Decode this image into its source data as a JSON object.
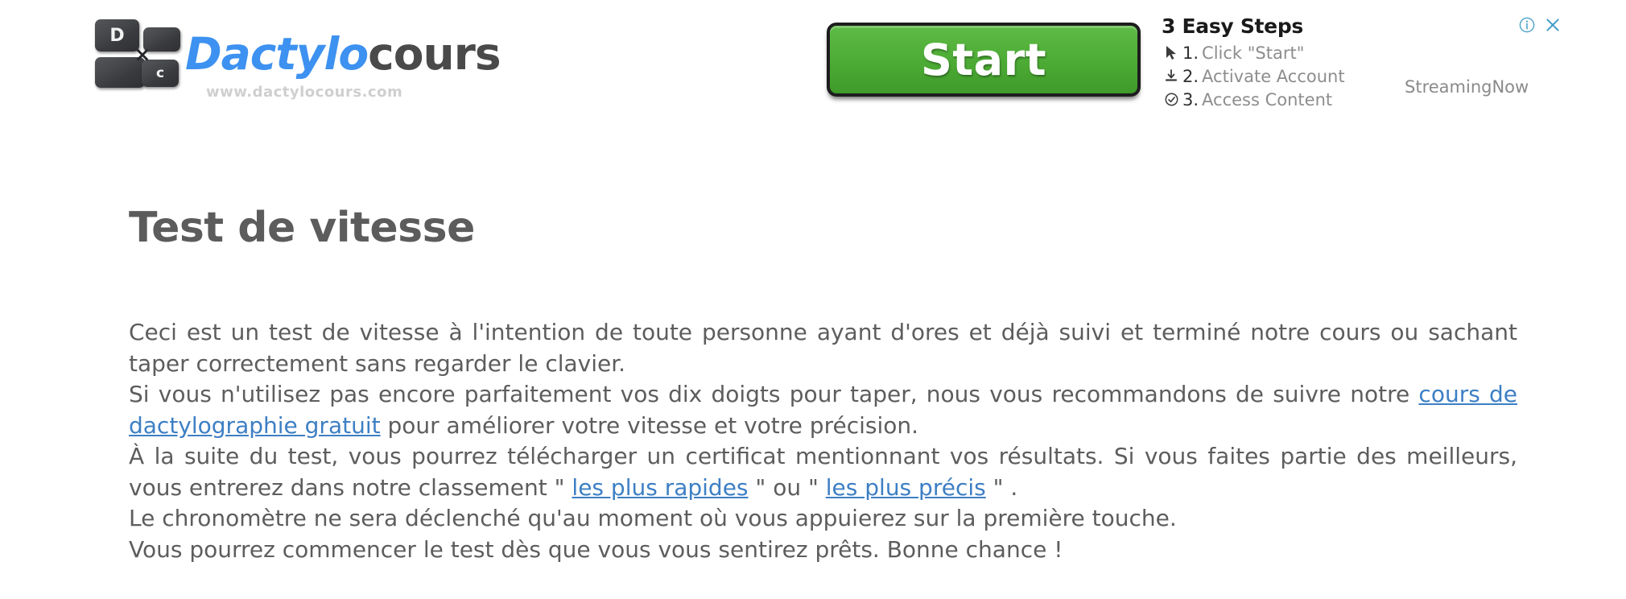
{
  "header": {
    "logo": {
      "key_top_left": "D",
      "key_bottom_right": "c",
      "key_x": "×",
      "brand_part1": "Dactylo",
      "brand_part2": "cours",
      "url": "www.dactylocours.com"
    },
    "ad": {
      "start_label": "Start",
      "steps_title": "3 Easy Steps",
      "steps": [
        {
          "icon": "cursor-arrow-icon",
          "glyph": "➤",
          "num": "1.",
          "label": "Click \"Start\""
        },
        {
          "icon": "download-icon",
          "glyph": "⤓",
          "num": "2.",
          "label": "Activate Account"
        },
        {
          "icon": "check-circle-icon",
          "glyph": "✓",
          "num": "3.",
          "label": "Access Content"
        }
      ],
      "brand": "StreamingNow",
      "info_glyph": "ⓘ",
      "close_glyph": "✕",
      "accent_color": "#3d9bc7",
      "button_color": "#4fae37"
    }
  },
  "main": {
    "title": "Test de vitesse",
    "paragraphs": {
      "p1": "Ceci est un test de vitesse à l'intention de toute personne ayant d'ores et déjà suivi et terminé notre cours ou sachant taper correctement sans regarder le clavier.",
      "p2_before": "Si vous n'utilisez pas encore parfaitement vos dix doigts pour taper, nous vous recommandons de suivre notre ",
      "p2_link": "cours de dactylographie gratuit",
      "p2_after": " pour améliorer votre vitesse et votre précision.",
      "p3_before": "À la suite du test, vous pourrez télécharger un certificat mentionnant vos résultats. Si vous faites partie des meilleurs, vous entrerez dans notre classement \" ",
      "p3_link1": "les plus rapides",
      "p3_middle": " \" ou \" ",
      "p3_link2": "les plus précis",
      "p3_after": " \" .",
      "p4": "Le chronomètre ne sera déclenché qu'au moment où vous appuierez sur la première touche.",
      "p5": "Vous pourrez commencer le test dès que vous vous sentirez prêts. Bonne chance !"
    },
    "text_color": "#5d5d5d",
    "link_color": "#3d7fc4"
  }
}
